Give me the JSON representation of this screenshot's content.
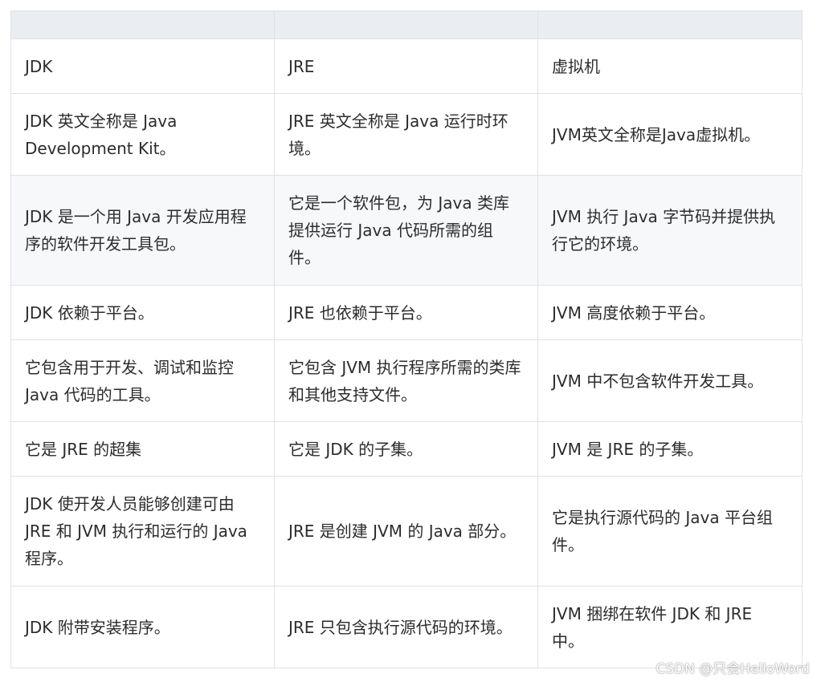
{
  "table": {
    "headers": [
      "",
      "",
      ""
    ],
    "rows": [
      [
        "JDK",
        "JRE",
        "虚拟机"
      ],
      [
        "JDK 英文全称是 Java Development Kit。",
        "JRE 英文全称是 Java 运行时环境。",
        "JVM英文全称是Java虚拟机。"
      ],
      [
        "JDK 是一个用 Java 开发应用程序的软件开发工具包。",
        "它是一个软件包，为 Java 类库提供运行 Java 代码所需的组件。",
        "JVM 执行 Java 字节码并提供执行它的环境。"
      ],
      [
        "JDK 依赖于平台。",
        "JRE 也依赖于平台。",
        "JVM 高度依赖于平台。"
      ],
      [
        "它包含用于开发、调试和监控 Java 代码的工具。",
        "它包含 JVM 执行程序所需的类库和其他支持文件。",
        "JVM 中不包含软件开发工具。"
      ],
      [
        "它是 JRE 的超集",
        "它是 JDK 的子集。",
        "JVM 是 JRE 的子集。"
      ],
      [
        "JDK 使开发人员能够创建可由 JRE 和 JVM 执行和运行的 Java 程序。",
        "JRE 是创建 JVM 的 Java 部分。",
        "它是执行源代码的 Java 平台组件。"
      ],
      [
        "JDK 附带安装程序。",
        "JRE 只包含执行源代码的环境。",
        "JVM 捆绑在软件 JDK 和 JRE 中。"
      ]
    ]
  },
  "watermark": "CSDN @只会HelloWord"
}
